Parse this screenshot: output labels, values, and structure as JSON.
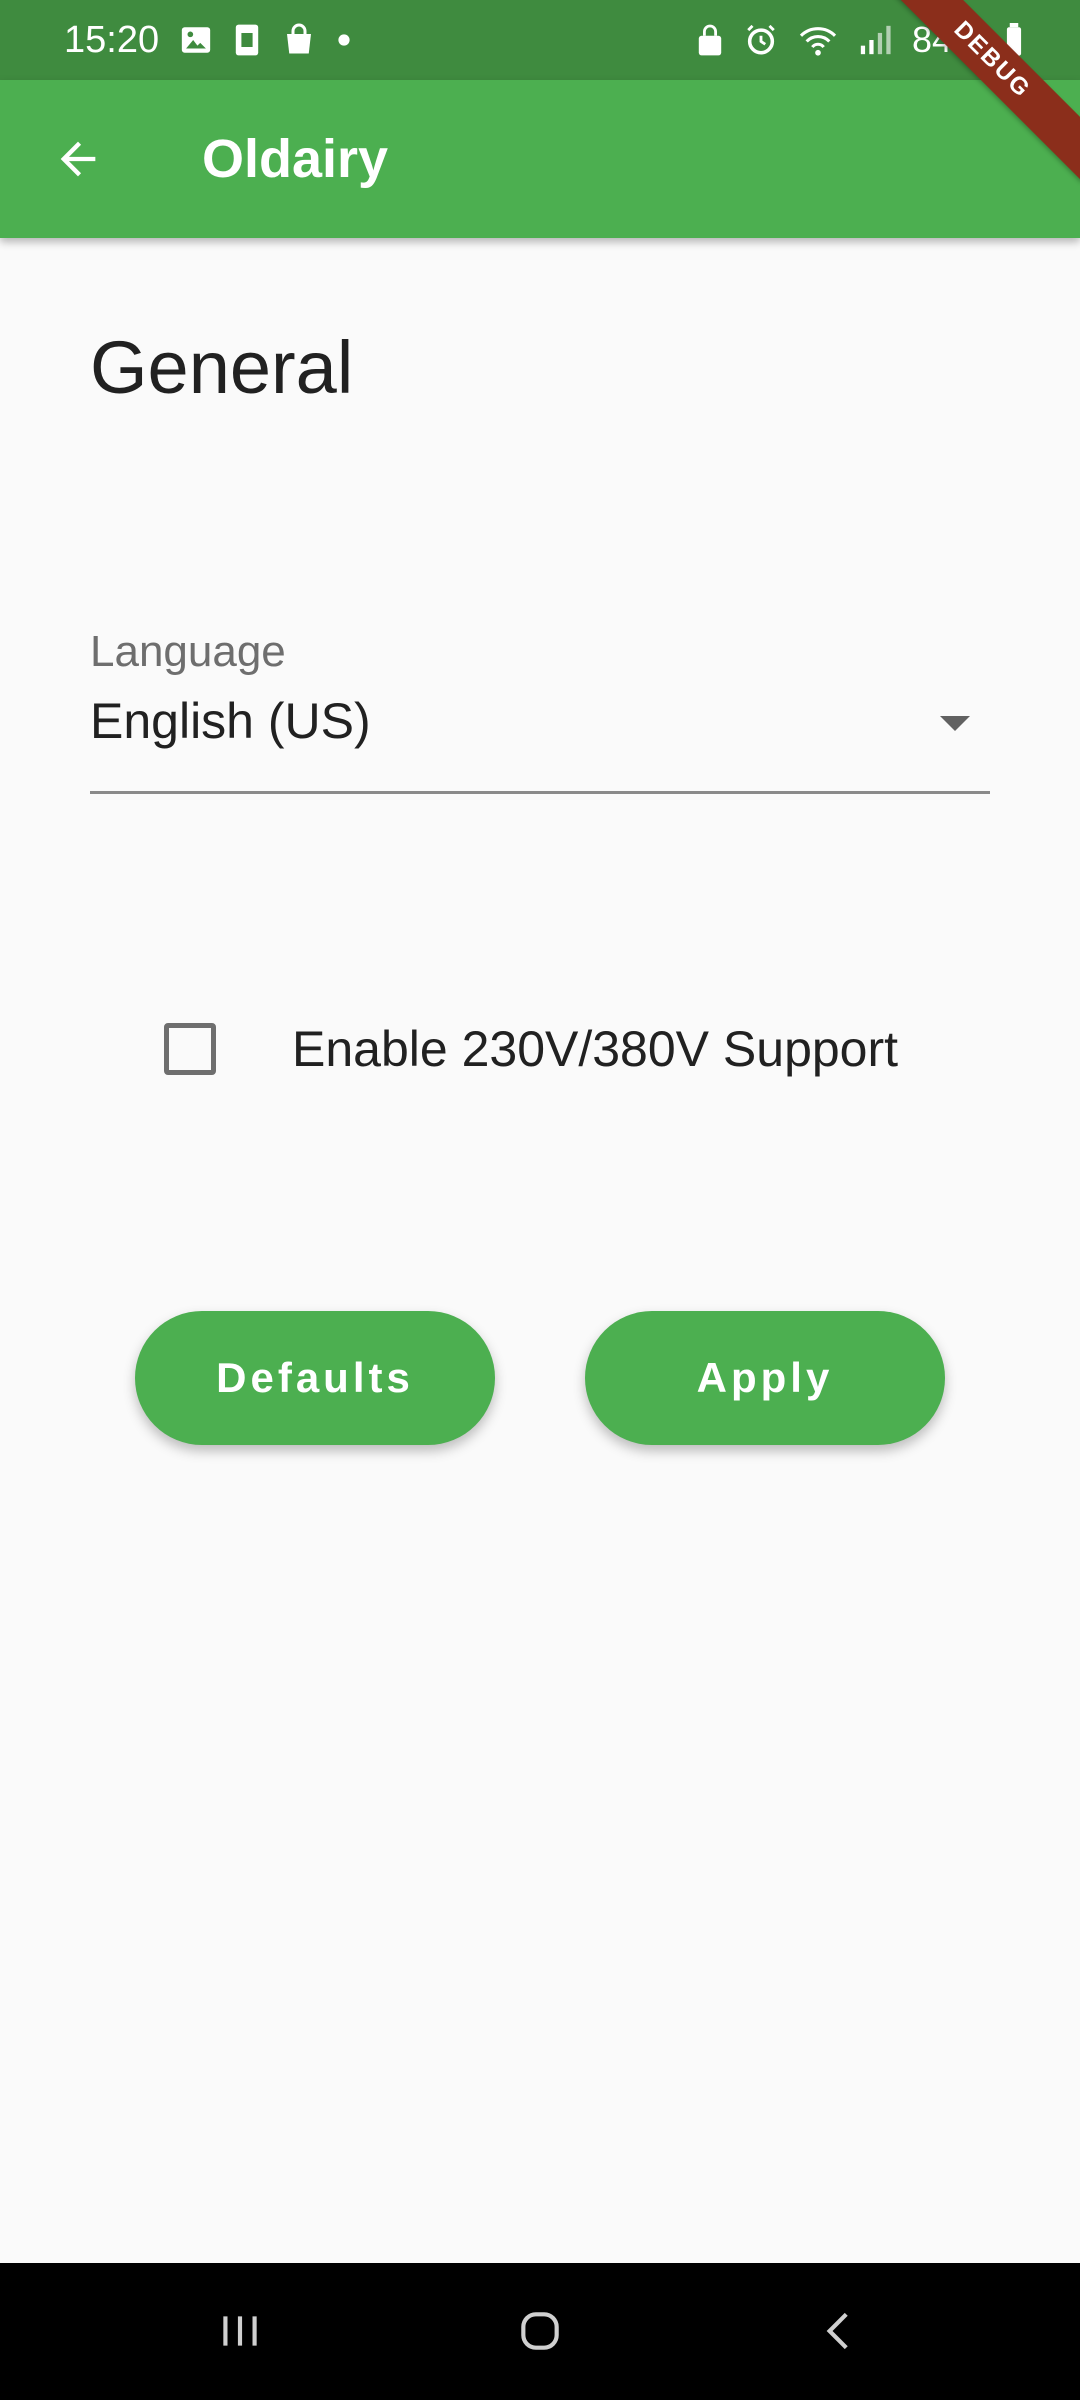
{
  "status_bar": {
    "time": "15:20",
    "battery": "84%",
    "left_icons": [
      "image-icon",
      "sim-icon",
      "shopping-bag-icon",
      "dot-icon"
    ],
    "right_icons": [
      "lock-icon",
      "alarm-icon",
      "wifi-icon",
      "signal-icon",
      "battery-icon"
    ]
  },
  "app_bar": {
    "title": "Oldairy",
    "back_icon": "arrow-back-icon",
    "color": "#4CAF50"
  },
  "debug_banner": {
    "label": "DEBUG",
    "color": "#8B2E1B"
  },
  "page": {
    "section_title": "General",
    "language": {
      "label": "Language",
      "selected": "English (US)"
    },
    "voltage_option": {
      "label": "Enable 230V/380V Support",
      "checked": false
    },
    "buttons": {
      "defaults": "Defaults",
      "apply": "Apply"
    }
  },
  "nav_bar": {
    "icons": [
      "recent-apps-icon",
      "home-icon",
      "back-icon"
    ]
  }
}
